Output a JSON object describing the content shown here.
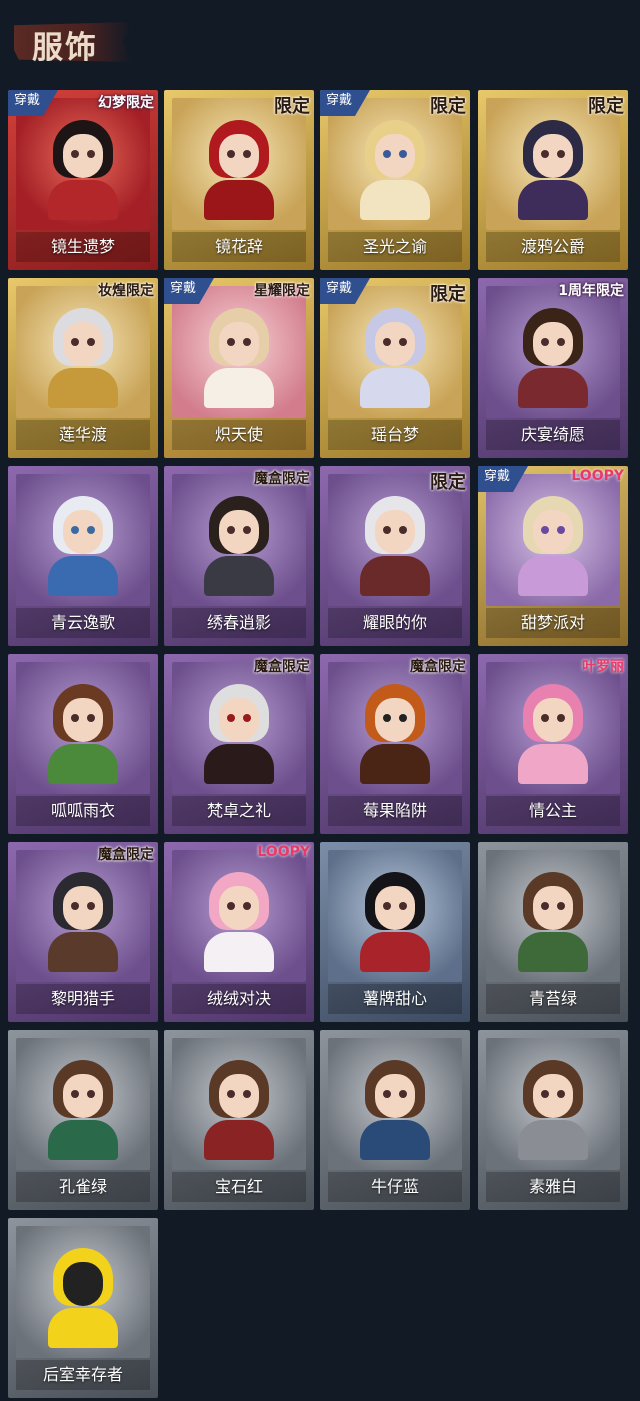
{
  "header": {
    "title": "服饰"
  },
  "items": [
    {
      "label": "镜生遗梦",
      "badge_wear": "穿戴",
      "tag": "幻梦限定"
    },
    {
      "label": "镜花辞",
      "badge_wear": "",
      "tag": "限定"
    },
    {
      "label": "圣光之谕",
      "badge_wear": "穿戴",
      "tag": "限定"
    },
    {
      "label": "渡鸦公爵",
      "badge_wear": "",
      "tag": "限定"
    },
    {
      "label": "莲华渡",
      "badge_wear": "",
      "tag": "妆煌限定"
    },
    {
      "label": "炽天使",
      "badge_wear": "穿戴",
      "tag": "星耀限定"
    },
    {
      "label": "瑶台梦",
      "badge_wear": "穿戴",
      "tag": "限定"
    },
    {
      "label": "庆宴绮愿",
      "badge_wear": "",
      "tag": "1周年限定"
    },
    {
      "label": "青云逸歌",
      "badge_wear": "",
      "tag": ""
    },
    {
      "label": "绣春逍影",
      "badge_wear": "",
      "tag": "魔盒限定"
    },
    {
      "label": "耀眼的你",
      "badge_wear": "",
      "tag": "限定"
    },
    {
      "label": "甜梦派对",
      "badge_wear": "穿戴",
      "tag": "LOOPY"
    },
    {
      "label": "呱呱雨衣",
      "badge_wear": "",
      "tag": ""
    },
    {
      "label": "梵卓之礼",
      "badge_wear": "",
      "tag": "魔盒限定"
    },
    {
      "label": "莓果陷阱",
      "badge_wear": "",
      "tag": "魔盒限定"
    },
    {
      "label": "情公主",
      "badge_wear": "",
      "tag": "叶罗丽"
    },
    {
      "label": "黎明猎手",
      "badge_wear": "",
      "tag": "魔盒限定"
    },
    {
      "label": "绒绒对决",
      "badge_wear": "",
      "tag": "LOOPY"
    },
    {
      "label": "薯牌甜心",
      "badge_wear": "",
      "tag": ""
    },
    {
      "label": "青苔绿",
      "badge_wear": "",
      "tag": ""
    },
    {
      "label": "孔雀绿",
      "badge_wear": "",
      "tag": ""
    },
    {
      "label": "宝石红",
      "badge_wear": "",
      "tag": ""
    },
    {
      "label": "牛仔蓝",
      "badge_wear": "",
      "tag": ""
    },
    {
      "label": "素雅白",
      "badge_wear": "",
      "tag": ""
    },
    {
      "label": "后室幸存者",
      "badge_wear": "",
      "tag": ""
    }
  ],
  "colors": {
    "background": "#121a26",
    "title_text": "#eadcc8",
    "wear_badge": "#2f4f8e"
  }
}
